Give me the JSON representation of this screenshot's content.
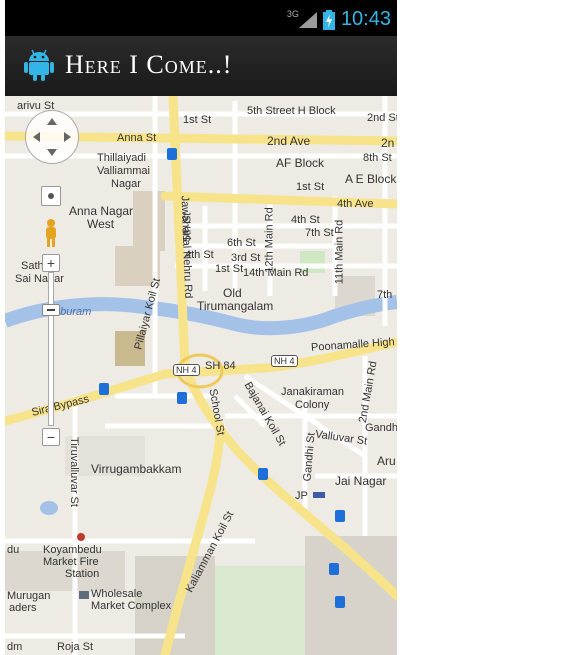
{
  "status_bar": {
    "network": "3G",
    "time": "10:43",
    "time_color": "#33b5e5"
  },
  "action_bar": {
    "title": "Here I Come..!",
    "icon": "android-icon"
  },
  "map": {
    "controls": {
      "pan": "pan-control-icon",
      "pegman": "pegman-icon",
      "zoom_in": "+",
      "zoom_out": "−"
    },
    "labels": {
      "arivu_st": "arivu St",
      "fifth_street_h_block": "5th Street H Block",
      "first_st_a": "1st St",
      "second_st_a": "2nd St",
      "anna_st": "Anna St",
      "second_ave": "2nd Ave",
      "second_ave_b": "2n",
      "thillaiyadi": "Thillaiyadi",
      "valliammai": "Valliammai",
      "nagar": "Nagar",
      "af_block": "AF Block",
      "eighth_st": "8th St",
      "first_st_b": "1st St",
      "ae_block": "A E Block",
      "anna_nagar_west_1": "Anna Nagar",
      "anna_nagar_west_2": "West",
      "fourth_ave": "4th Ave",
      "jawaharlal": "Jawaharlal Nehru Rd",
      "fifth_st": "5th St",
      "fourth_st_a": "4th St",
      "seventh_st_a": "7th St",
      "sixth_st": "6th St",
      "twelfth_main": "12th Main Rd",
      "eleventh_main": "11th Main Rd",
      "fourth_st_b": "4th St",
      "third_st": "3rd St",
      "first_st_c": "1st St",
      "fourteenth_main": "14th Main Rd",
      "sathi_1": "Sath",
      "sathi_2": "Sai Nagar",
      "old_tirumangalam_1": "Old",
      "old_tirumangalam_2": "Tirumangalam",
      "seventh_right": "7th",
      "pillaiyar": "Pillaiyar Koil St",
      "puram": "mburam",
      "poonamalle": "Poonamalle High",
      "nh4_a": "NH 4",
      "sh84": "SH 84",
      "nh4_b": "NH 4",
      "second_main": "2nd Main Rd",
      "janakiraman_1": "Janakiraman",
      "janakiraman_2": "Colony",
      "sira_bypass": "Sira Bypass",
      "school_st": "School St",
      "bajanai": "Bajanai Koil St",
      "valluvar": "Valluvar St",
      "gandhi_a": "Gandhi",
      "gandhi_st": "Gandhi St",
      "aru": "Aru",
      "thiruvalluvar": "Tiruvalluvar St",
      "virrugambakkam": "Virrugambakkam",
      "jai_nagar": "Jai Nagar",
      "jp": "JP",
      "kaliamman": "Kaliamman Koil St",
      "du": "du",
      "koyambedu_1": "Koyambedu",
      "koyambedu_2": "Market Fire",
      "koyambedu_3": "Station",
      "murugan": "Murugan",
      "aders": "aders",
      "wholesale_1": "Wholesale",
      "wholesale_2": "Market Complex",
      "roja_st": "Roja St",
      "dm": "dm"
    }
  }
}
